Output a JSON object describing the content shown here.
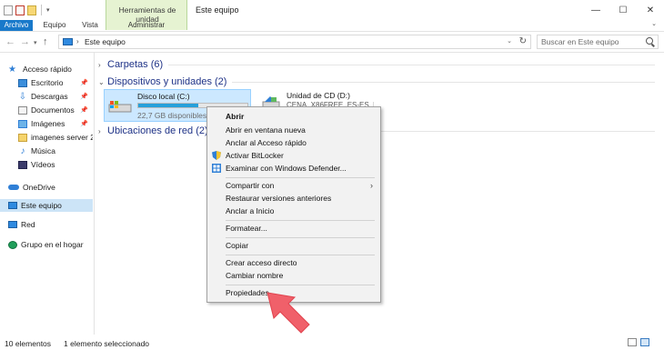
{
  "window": {
    "title": "Este equipo",
    "context_tab_group": "Herramientas de unidad",
    "minimize": "—",
    "maximize": "☐",
    "close": "✕"
  },
  "ribbon": {
    "tabs": [
      "Archivo",
      "Equipo",
      "Vista",
      "Administrar"
    ],
    "active_tab": "Archivo",
    "accent_color": "#1979ca",
    "context_color": "#e6f3d2"
  },
  "address": {
    "path": "Este equipo",
    "search_placeholder": "Buscar en Este equipo"
  },
  "nav_pane": {
    "items": [
      {
        "label": "Acceso rápido",
        "icon": "star-icon",
        "pinned": false
      },
      {
        "label": "Escritorio",
        "icon": "desktop-folder-icon",
        "pinned": true
      },
      {
        "label": "Descargas",
        "icon": "downloads-folder-icon",
        "pinned": true
      },
      {
        "label": "Documentos",
        "icon": "documents-folder-icon",
        "pinned": true
      },
      {
        "label": "Imágenes",
        "icon": "pictures-folder-icon",
        "pinned": true
      },
      {
        "label": "imagenes server 201",
        "icon": "folder-icon",
        "pinned": false
      },
      {
        "label": "Música",
        "icon": "music-folder-icon",
        "pinned": false
      },
      {
        "label": "Vídeos",
        "icon": "videos-folder-icon",
        "pinned": false
      },
      {
        "label": "OneDrive",
        "icon": "onedrive-cloud-icon",
        "pinned": false
      },
      {
        "label": "Este equipo",
        "icon": "computer-icon",
        "pinned": false
      },
      {
        "label": "Red",
        "icon": "network-icon",
        "pinned": false
      },
      {
        "label": "Grupo en el hogar",
        "icon": "homegroup-icon",
        "pinned": false
      }
    ],
    "selected": "Este equipo"
  },
  "content": {
    "groups": [
      {
        "label": "Carpetas (6)",
        "expanded": false
      },
      {
        "label": "Dispositivos y unidades (2)",
        "expanded": true
      },
      {
        "label": "Ubicaciones de red (2)",
        "expanded": false
      }
    ],
    "drive_c": {
      "name": "Disco local (C:)",
      "space": "22,7 GB disponibles de",
      "used_fraction": 0.55
    },
    "drive_d": {
      "name": "Unidad de CD (D:)",
      "label": "CENA_X86FREE_ES-ES_DVS"
    }
  },
  "context_menu": {
    "items": [
      {
        "label": "Abrir",
        "bold": true
      },
      {
        "label": "Abrir en ventana nueva"
      },
      {
        "label": "Anclar al Acceso rápido"
      },
      {
        "label": "Activar BitLocker",
        "icon": "shield-icon"
      },
      {
        "label": "Examinar con Windows Defender...",
        "icon": "windows-defender-icon"
      },
      {
        "label": "Compartir con",
        "submenu": true
      },
      {
        "label": "Restaurar versiones anteriores"
      },
      {
        "label": "Anclar a Inicio"
      },
      {
        "label": "Formatear..."
      },
      {
        "label": "Copiar"
      },
      {
        "label": "Crear acceso directo"
      },
      {
        "label": "Cambiar nombre"
      },
      {
        "label": "Propiedades"
      }
    ],
    "submenu_glyph": "›"
  },
  "status": {
    "count": "10 elementos",
    "selection": "1 elemento seleccionado"
  },
  "annotation": {
    "arrow_color": "#f0606a"
  }
}
